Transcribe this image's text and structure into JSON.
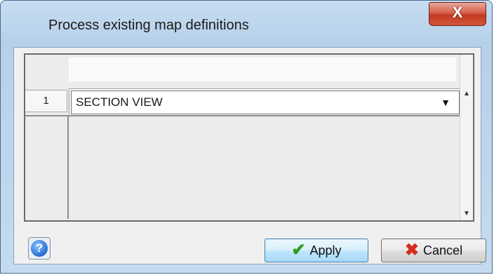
{
  "window": {
    "title": "Process existing map definitions",
    "close_glyph": "X"
  },
  "grid": {
    "rows": [
      {
        "number": "1",
        "value": "SECTION VIEW"
      }
    ]
  },
  "icons": {
    "help": "help-icon",
    "apply": "check-icon",
    "cancel": "cancel-x-icon",
    "dropdown": "chevron-down-icon"
  },
  "footer": {
    "help_glyph": "?",
    "apply_label": "Apply",
    "cancel_label": "Cancel"
  },
  "colors": {
    "apply_check": "#2f9a1f",
    "cancel_x": "#d62b1f",
    "close_button": "#c33a22"
  }
}
